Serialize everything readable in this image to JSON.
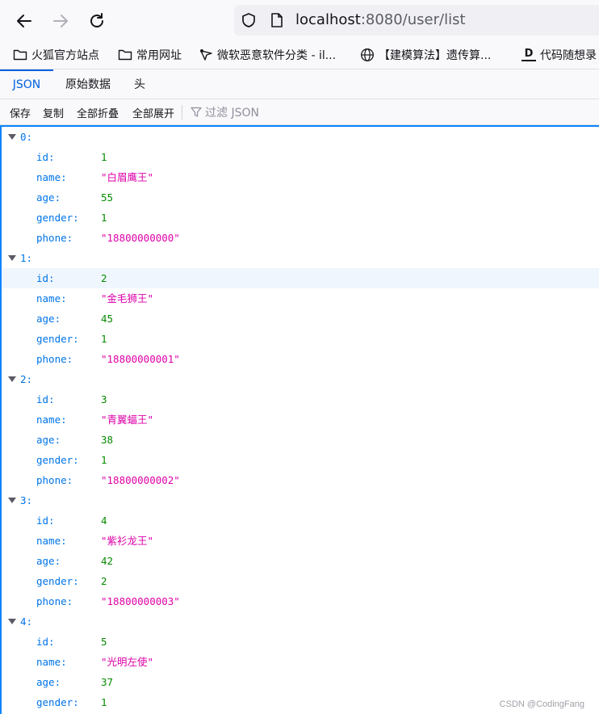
{
  "url": {
    "host": "localhost",
    "rest": ":8080/user/list"
  },
  "bookmarks": [
    {
      "label": "火狐官方站点",
      "icon": "folder-icon"
    },
    {
      "label": "常用网址",
      "icon": "folder-icon"
    },
    {
      "label": "微软恶意软件分类 - il...",
      "icon": "bookmark-site-icon"
    },
    {
      "label": "【建模算法】遗传算...",
      "icon": "globe-icon"
    },
    {
      "label": "代码随想录",
      "icon": "d-logo-icon"
    }
  ],
  "viewer_tabs": [
    "JSON",
    "原始数据",
    "头"
  ],
  "toolbar": {
    "save": "保存",
    "copy": "复制",
    "collapse_all": "全部折叠",
    "expand_all": "全部展开",
    "filter": "过滤 JSON"
  },
  "labels": {
    "id": "id:",
    "name": "name:",
    "age": "age:",
    "gender": "gender:",
    "phone": "phone:"
  },
  "users": [
    {
      "index": "0:",
      "id": "1",
      "name": "\"白眉鹰王\"",
      "age": "55",
      "gender": "1",
      "phone": "\"18800000000\""
    },
    {
      "index": "1:",
      "id": "2",
      "name": "\"金毛狮王\"",
      "age": "45",
      "gender": "1",
      "phone": "\"18800000001\""
    },
    {
      "index": "2:",
      "id": "3",
      "name": "\"青翼蝠王\"",
      "age": "38",
      "gender": "1",
      "phone": "\"18800000002\""
    },
    {
      "index": "3:",
      "id": "4",
      "name": "\"紫衫龙王\"",
      "age": "42",
      "gender": "2",
      "phone": "\"18800000003\""
    },
    {
      "index": "4:",
      "id": "5",
      "name": "\"光明左使\"",
      "age": "37",
      "gender": "1"
    }
  ],
  "watermark": "CSDN @CodingFang",
  "colors": {
    "accent": "#0060df",
    "key": "#0074e8",
    "number": "#058b00",
    "string": "#dd00a9"
  }
}
